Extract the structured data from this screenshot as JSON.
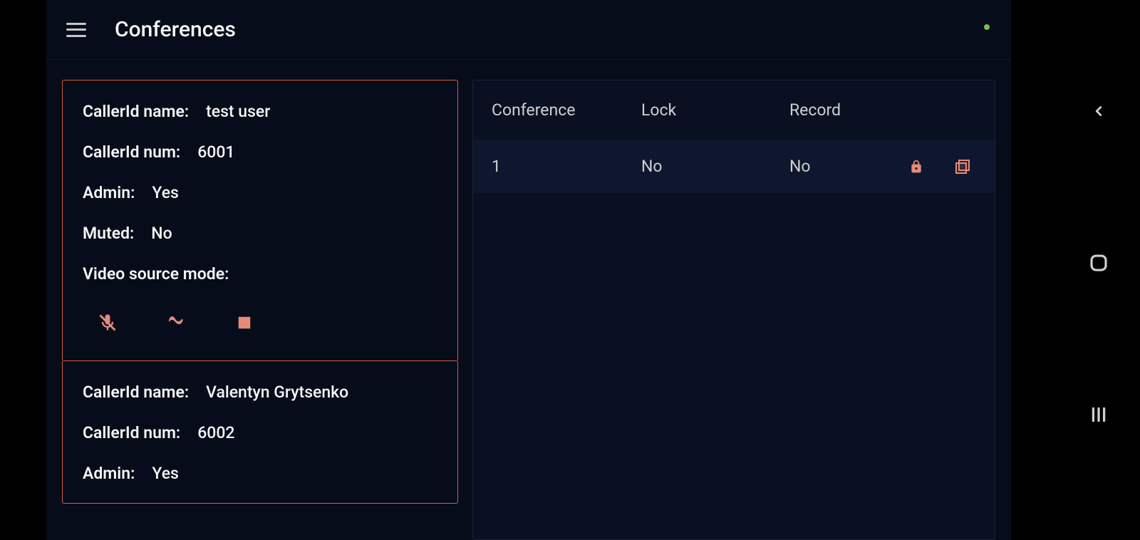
{
  "header": {
    "title": "Conferences"
  },
  "participants": [
    {
      "callerIdNameLabel": "CallerId name:",
      "callerIdNameValue": "test user",
      "callerIdNumLabel": "CallerId num:",
      "callerIdNumValue": "6001",
      "adminLabel": "Admin:",
      "adminValue": "Yes",
      "mutedLabel": "Muted:",
      "mutedValue": "No",
      "videoSourceModeLabel": "Video source mode:",
      "videoSourceModeValue": ""
    },
    {
      "callerIdNameLabel": "CallerId name:",
      "callerIdNameValue": "Valentyn Grytsenko",
      "callerIdNumLabel": "CallerId num:",
      "callerIdNumValue": "6002",
      "adminLabel": "Admin:",
      "adminValue": "Yes"
    }
  ],
  "table": {
    "headers": {
      "conference": "Conference",
      "lock": "Lock",
      "record": "Record"
    },
    "rows": [
      {
        "conference": "1",
        "lock": "No",
        "record": "No"
      }
    ]
  }
}
